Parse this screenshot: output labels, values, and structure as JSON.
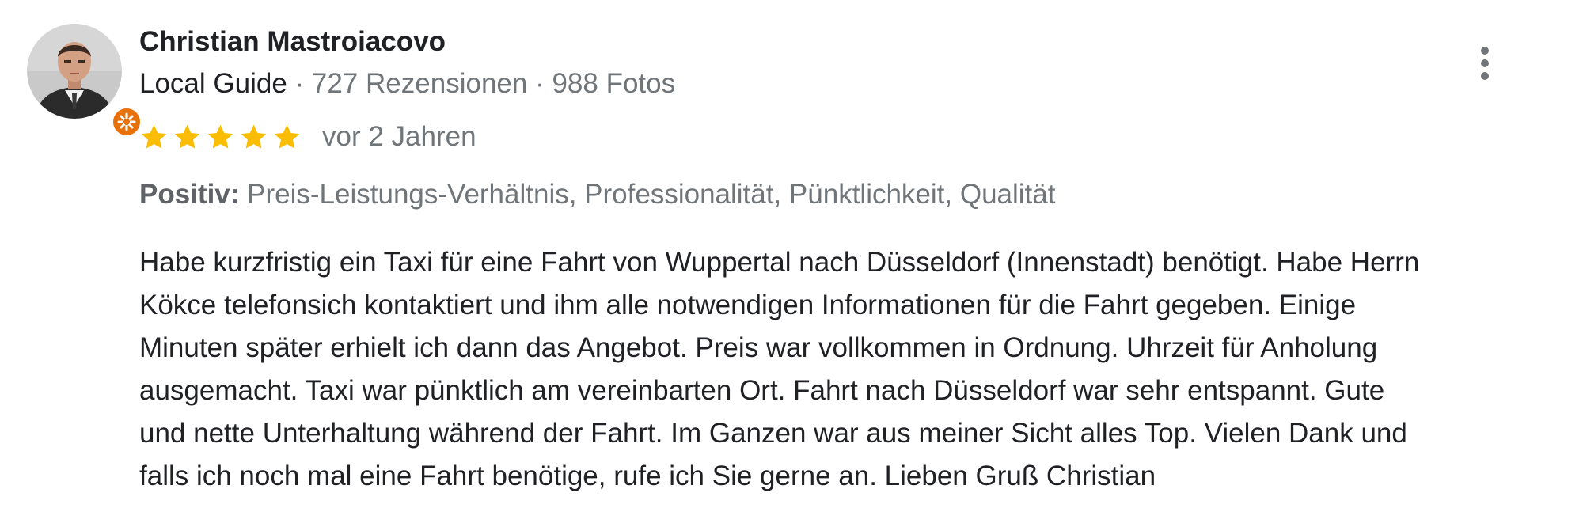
{
  "reviewer": {
    "name": "Christian Mastroiacovo",
    "level": "Local Guide",
    "separator": " · ",
    "reviews": "727 Rezensionen",
    "photos": "988 Fotos",
    "badge_icon": "local-guide-star-icon",
    "badge_color": "#e8710a"
  },
  "rating": {
    "stars": 5,
    "max": 5,
    "star_color": "#fbbc04",
    "date": "vor 2 Jahren"
  },
  "positive": {
    "label": "Positiv:",
    "items": " Preis-Leistungs-Verhältnis, Professionalität, Pünktlichkeit, Qualität"
  },
  "review_text": {
    "lines": [
      "Habe kurzfristig ein Taxi für eine Fahrt von Wuppertal nach Düsseldorf (Innenstadt) benötigt. Habe Herrn",
      "Kökce telefonsich kontaktiert und ihm alle notwendigen Informationen für die Fahrt gegeben. Einige",
      "Minuten später erhielt ich dann das Angebot. Preis war vollkommen in Ordnung. Uhrzeit für Anholung",
      "ausgemacht. Taxi war pünktlich am vereinbarten Ort. Fahrt nach Düsseldorf war sehr entspannt. Gute",
      "und nette Unterhaltung während der Fahrt. Im Ganzen war aus meiner Sicht alles Top. Vielen Dank und",
      "falls ich noch mal eine Fahrt benötige, rufe ich Sie gerne an. Lieben Gruß Christian"
    ]
  },
  "menu": {
    "icon": "more-vert-icon"
  }
}
